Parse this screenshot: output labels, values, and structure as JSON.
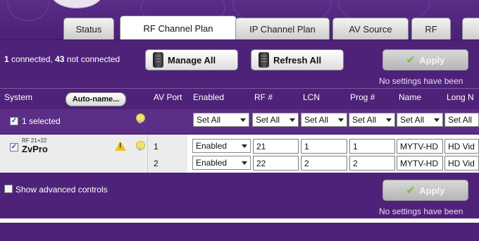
{
  "tabs": [
    {
      "label": "Status"
    },
    {
      "label": "RF Channel Plan",
      "active": true
    },
    {
      "label": "IP Channel Plan"
    },
    {
      "label": "AV Source"
    },
    {
      "label": "RF"
    }
  ],
  "toolbar": {
    "connected_count": "1",
    "connected_label": "connected,",
    "not_connected_count": "43",
    "not_connected_label": "not connected",
    "manage_all": "Manage All",
    "refresh_all": "Refresh All",
    "apply": "Apply",
    "no_settings": "No settings have been"
  },
  "columns": {
    "system": "System",
    "auto_name": "Auto-name...",
    "av_port": "AV Port",
    "enabled": "Enabled",
    "rf": "RF #",
    "lcn": "LCN",
    "prog": "Prog #",
    "name": "Name",
    "long_name": "Long N"
  },
  "selection": {
    "label": "1 selected",
    "set_all": "Set All"
  },
  "device": {
    "rf_label": "RF 21+22",
    "name": "ZvPro",
    "rows": [
      {
        "port": "1",
        "enabled": "Enabled",
        "rf": "21",
        "lcn": "1",
        "prog": "1",
        "name": "MYTV-HD",
        "long_name": "HD Vid"
      },
      {
        "port": "2",
        "enabled": "Enabled",
        "rf": "22",
        "lcn": "2",
        "prog": "2",
        "name": "MYTV-HD",
        "long_name": "HD Vid"
      }
    ]
  },
  "footer": {
    "show_advanced": "Show advanced controls",
    "apply": "Apply",
    "no_settings": "No settings have been"
  },
  "colors": {
    "panel": "#4f2279",
    "accent_check": "#7fc24a",
    "warning": "#e8c12d"
  }
}
